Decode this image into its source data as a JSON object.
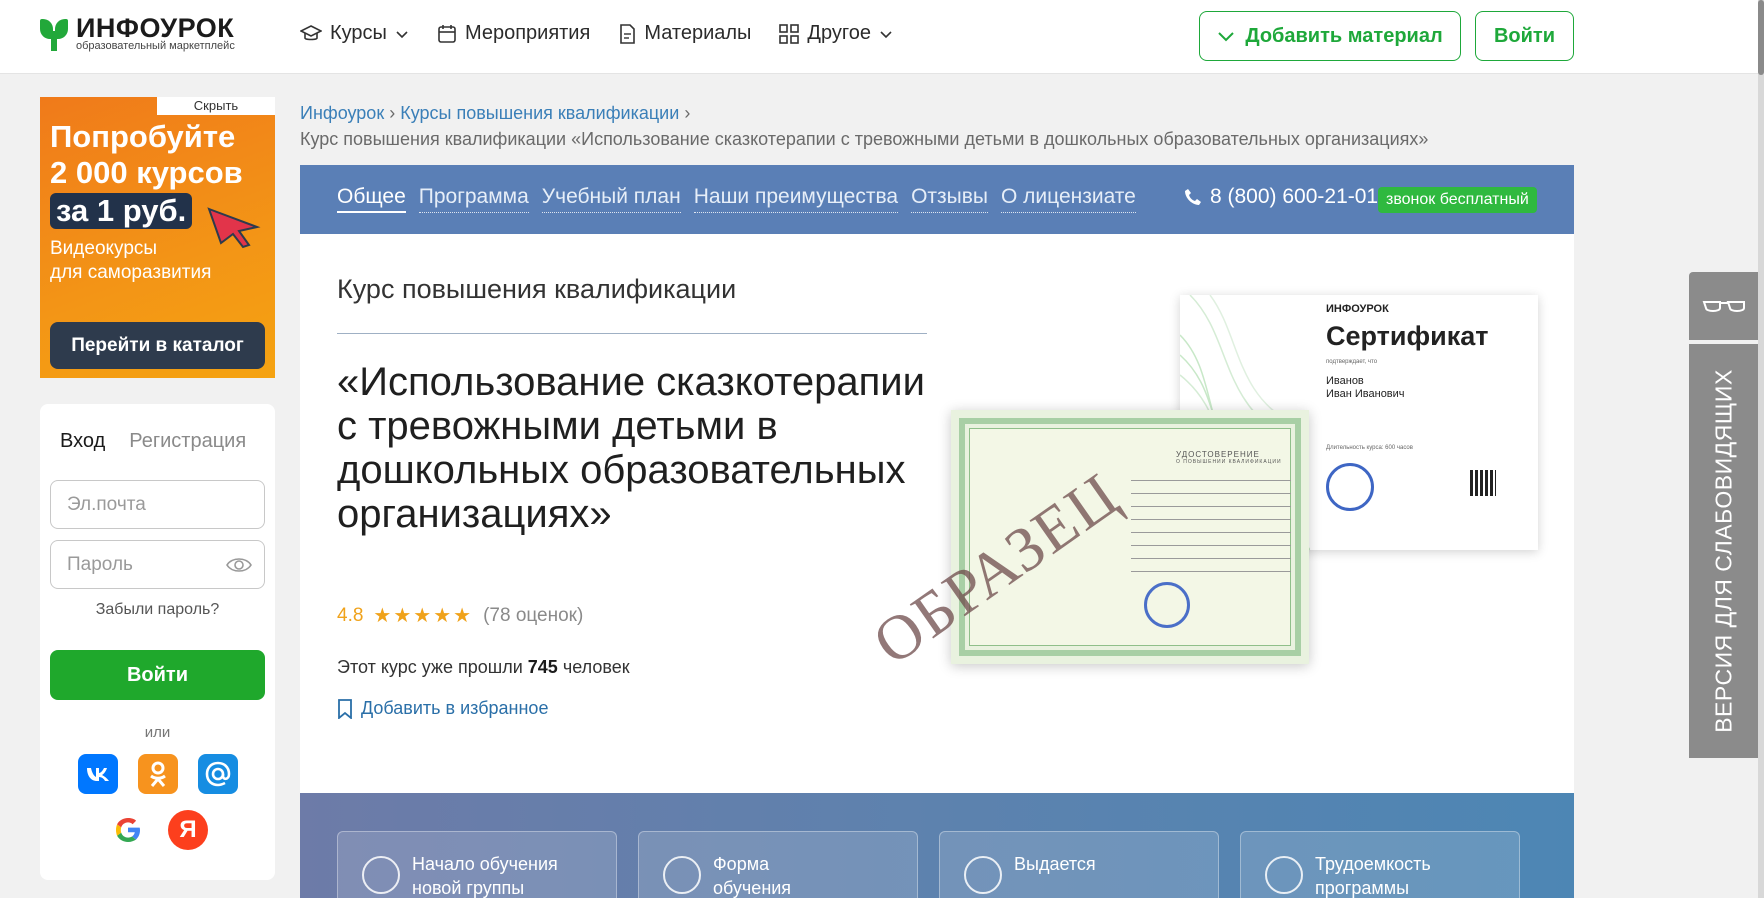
{
  "header": {
    "logo_title": "ИНФОУРОК",
    "logo_subtitle": "образовательный маркетплейс",
    "nav": [
      {
        "label": "Курсы",
        "icon": "graduation-cap-icon",
        "dropdown": true
      },
      {
        "label": "Мероприятия",
        "icon": "calendar-icon",
        "dropdown": false
      },
      {
        "label": "Материалы",
        "icon": "document-icon",
        "dropdown": false
      },
      {
        "label": "Другое",
        "icon": "grid-icon",
        "dropdown": true
      }
    ],
    "add_material": "Добавить материал",
    "login": "Войти"
  },
  "promo": {
    "hide": "Скрыть",
    "line1": "Попробуйте",
    "line2": "2 000 курсов",
    "line3": "за 1 руб.",
    "sub1": "Видеокурсы",
    "sub2": "для саморазвития",
    "button": "Перейти в каталог"
  },
  "login_card": {
    "tab_login": "Вход",
    "tab_register": "Регистрация",
    "email_placeholder": "Эл.почта",
    "password_placeholder": "Пароль",
    "forgot": "Забыли пароль?",
    "submit": "Войти",
    "or": "или",
    "socials": [
      "vk-icon",
      "odnoklassniki-icon",
      "mail-icon",
      "google-icon",
      "yandex-icon"
    ]
  },
  "breadcrumb": {
    "home": "Инфоурок",
    "section": "Курсы повышения квалификации",
    "current": "Курс повышения квалификации «Использование сказкотерапии с тревожными детьми в дошкольных образовательных организациях»"
  },
  "course": {
    "tabs": [
      "Общее",
      "Программа",
      "Учебный план",
      "Наши преимущества",
      "Отзывы",
      "О лицензиате"
    ],
    "phone": "8 (800) 600-21-01",
    "free_call": "звонок бесплатный",
    "kind": "Курс повышения квалификации",
    "title": "«Использование сказкотерапии с тревожными детьми в дошкольных образовательных организациях»",
    "rating": "4.8",
    "stars": "★★★★★",
    "rating_count": "(78 оценок)",
    "passed_prefix": "Этот курс уже прошли",
    "passed_count": "745",
    "passed_suffix": "человек",
    "favorite": "Добавить в избранное",
    "certificate": {
      "logo": "ИНФОУРОК",
      "title": "Сертификат",
      "confirms": "подтверждает, что",
      "name_line1": "Иванов",
      "name_line2": "Иван Иванович",
      "duration": "Длительность курса: 600 часов"
    },
    "diploma": {
      "title": "УДОСТОВЕРЕНИЕ",
      "subtitle": "О ПОВЫШЕНИИ КВАЛИФИКАЦИИ",
      "watermark": "ОБРАЗЕЦ"
    },
    "info_cards": [
      {
        "label_1": "Начало обучения",
        "label_2": "новой группы"
      },
      {
        "label_1": "Форма",
        "label_2": "обучения"
      },
      {
        "label_1": "Выдается",
        "label_2": ""
      },
      {
        "label_1": "Трудоемкость",
        "label_2": "программы"
      }
    ]
  },
  "accessibility": {
    "label": "ВЕРСИЯ ДЛЯ СЛАБОВИДЯЩИХ",
    "icon": "glasses-icon"
  }
}
